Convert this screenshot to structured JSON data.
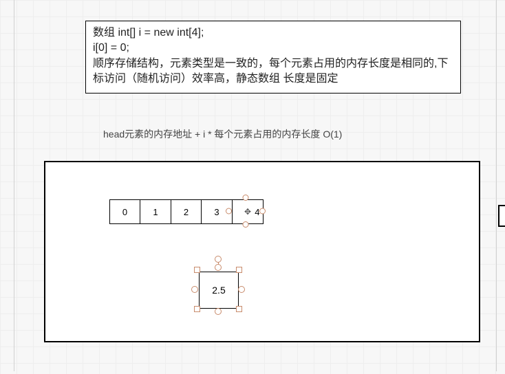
{
  "textBox": {
    "line1": "数组  int[] i = new int[4];",
    "line2": "i[0] = 0;",
    "line3": "顺序存储结构，元素类型是一致的，每个元素占用的内存长度是相同的,下标访问（随机访问）效率高，静态数组  长度是固定"
  },
  "formula": "head元素的内存地址 + i * 每个元素占用的内存长度   O(1)",
  "array": {
    "cells": [
      "0",
      "1",
      "2",
      "3",
      "4"
    ],
    "selectedIndex": 4
  },
  "floatingBox": {
    "value": "2.5"
  }
}
